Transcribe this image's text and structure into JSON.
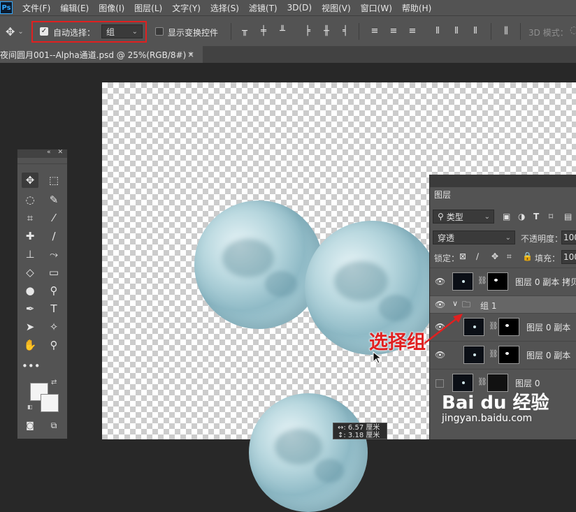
{
  "app": {
    "logo": "Ps"
  },
  "menu": [
    "文件(F)",
    "编辑(E)",
    "图像(I)",
    "图层(L)",
    "文字(Y)",
    "选择(S)",
    "滤镜(T)",
    "3D(D)",
    "视图(V)",
    "窗口(W)",
    "帮助(H)"
  ],
  "options": {
    "auto_select_label": "自动选择：",
    "auto_select_checked": true,
    "auto_select_value": "组",
    "show_transform_label": "显示变换控件",
    "mode3d_label": "3D 模式："
  },
  "document": {
    "tab_title": "夜间圆月001--Alpha通道.psd @ 25%(RGB/8#) *",
    "close": "×"
  },
  "layers_panel": {
    "tab": "图层",
    "filter_kind": "类型",
    "blend_mode": "穿透",
    "opacity_label": "不透明度：",
    "opacity_value": "100",
    "lock_label": "锁定：",
    "fill_label": "填充：",
    "fill_value": "100",
    "layers": [
      {
        "name": "图层 0 副本 拷贝",
        "visible": true,
        "type": "layer"
      },
      {
        "name": "组 1",
        "visible": true,
        "type": "group"
      },
      {
        "name": "图层 0 副本",
        "visible": true,
        "type": "layer"
      },
      {
        "name": "图层 0 副本",
        "visible": true,
        "type": "layer"
      },
      {
        "name": "图层 0",
        "visible": false,
        "type": "layer"
      }
    ]
  },
  "annotation": {
    "text": "选择组",
    "color": "#e02020"
  },
  "measure": {
    "line1": "↔: 6.57 厘米",
    "line2": "↕: 3.18 厘米"
  },
  "watermark": {
    "main": "Bai du 经验",
    "sub": "jingyan.baidu.com"
  }
}
